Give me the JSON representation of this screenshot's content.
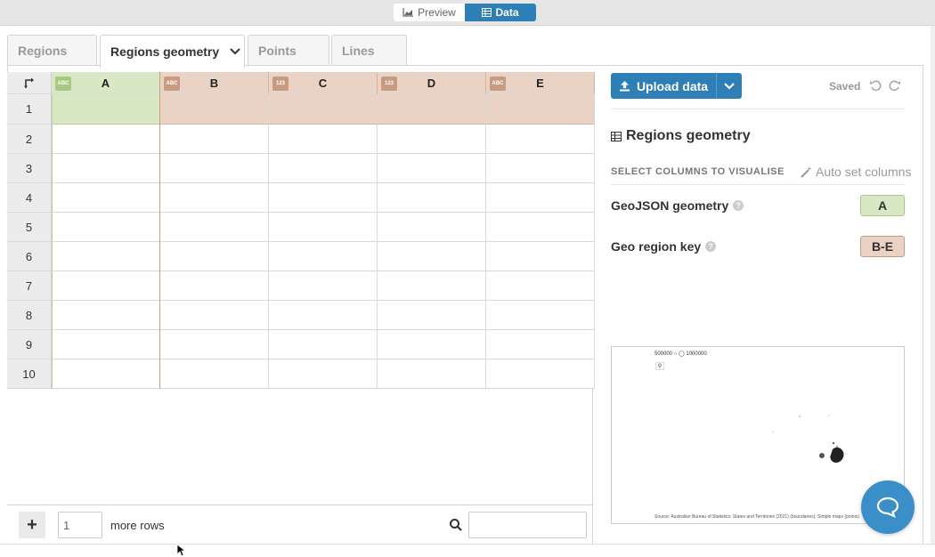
{
  "toolbar": {
    "preview_label": "Preview",
    "data_label": "Data"
  },
  "tabs": [
    {
      "label": "Regions",
      "active": false
    },
    {
      "label": "Regions geometry",
      "active": true
    },
    {
      "label": "Points",
      "active": false
    },
    {
      "label": "Lines",
      "active": false
    }
  ],
  "grid": {
    "columns": [
      {
        "letter": "A",
        "type": "ABC"
      },
      {
        "letter": "B",
        "type": "ABC"
      },
      {
        "letter": "C",
        "type": "123"
      },
      {
        "letter": "D",
        "type": "123"
      },
      {
        "letter": "E",
        "type": "ABC"
      }
    ],
    "rows": [
      "1",
      "2",
      "3",
      "4",
      "5",
      "6",
      "7",
      "8",
      "9",
      "10"
    ]
  },
  "footer": {
    "rows_value": "1",
    "more_rows_label": "more rows",
    "search_value": ""
  },
  "right_panel": {
    "upload_label": "Upload data",
    "saved_label": "Saved",
    "section_title": "Regions geometry",
    "select_columns_label": "SELECT COLUMNS TO VISUALISE",
    "auto_set_label": "Auto set columns",
    "bindings": [
      {
        "label": "GeoJSON geometry",
        "columns": "A",
        "color": "#d9e8c4"
      },
      {
        "label": "Geo region key",
        "columns": "B-E",
        "color": "#ead3c5"
      }
    ]
  },
  "map_preview": {
    "legend": "500000 ○ ◯ 1000000",
    "source": "Source: Australian Bureau of Statistics: States and Territories (2021) (boundaries); Simple maps (points)"
  },
  "colors": {
    "accent": "#2d7fb6",
    "col_a": "#d9e8c4",
    "col_b_e": "#ead3c5",
    "badge_a": "#a9c983",
    "badge_b_e": "#c79a82"
  }
}
